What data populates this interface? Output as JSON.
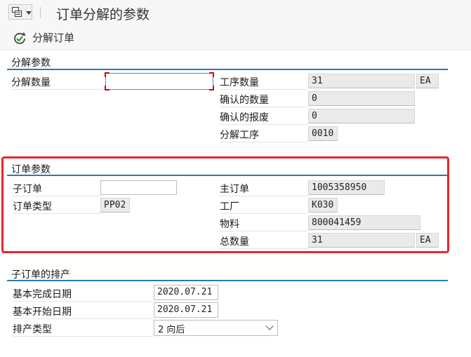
{
  "window": {
    "title": "订单分解的参数"
  },
  "toolbar": {
    "split_label": "分解订单"
  },
  "split_params": {
    "group_title": "分解参数",
    "split_qty_label": "分解数量",
    "split_qty_value": "",
    "op_qty_label": "工序数量",
    "op_qty_value": "31",
    "op_qty_unit": "EA",
    "confirmed_qty_label": "确认的数量",
    "confirmed_qty_value": "0",
    "confirmed_scrap_label": "确认的报废",
    "confirmed_scrap_value": "0",
    "split_op_label": "分解工序",
    "split_op_value": "0010"
  },
  "order_params": {
    "group_title": "订单参数",
    "child_order_label": "子订单",
    "child_order_value": "",
    "order_type_label": "订单类型",
    "order_type_value": "PP02",
    "main_order_label": "主订单",
    "main_order_value": "1005358950",
    "plant_label": "工厂",
    "plant_value": "K030",
    "material_label": "物料",
    "material_value": "800041459",
    "total_qty_label": "总数量",
    "total_qty_value": "31",
    "total_qty_unit": "EA"
  },
  "scheduling": {
    "group_title": "子订单的排产",
    "basic_finish_label": "基本完成日期",
    "basic_finish_value": "2020.07.21",
    "basic_start_label": "基本开始日期",
    "basic_start_value": "2020.07.21",
    "sched_type_label": "排产类型",
    "sched_type_value": "2 向后"
  },
  "icons": {
    "menu": "menu-icon",
    "split": "split-order-icon"
  },
  "colors": {
    "group_line": "#2979b5",
    "highlight": "#e8262d",
    "focus": "#3f8fd2"
  }
}
